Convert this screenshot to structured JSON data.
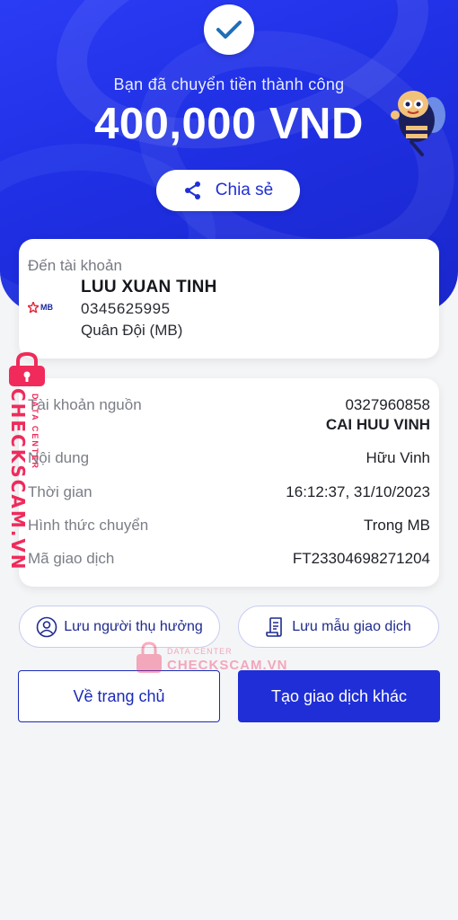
{
  "header": {
    "success_message": "Bạn đã chuyển tiền thành công",
    "amount": "400,000 VND",
    "share_label": "Chia sẻ"
  },
  "recipient": {
    "title": "Đến tài khoản",
    "bank_logo_text": "MB",
    "name": "LUU XUAN TINH",
    "account_number": "0345625995",
    "bank_name": "Quân Đội (MB)"
  },
  "details": {
    "source_label": "Tài khoản nguồn",
    "source_account": "0327960858",
    "source_name": "CAI HUU VINH",
    "content_label": "Nội dung",
    "content_value": "Hữu Vinh",
    "time_label": "Thời gian",
    "time_value": "16:12:37, 31/10/2023",
    "method_label": "Hình thức chuyển",
    "method_value": "Trong MB",
    "tx_id_label": "Mã giao dịch",
    "tx_id_value": "FT23304698271204"
  },
  "actions": {
    "save_beneficiary": "Lưu người thụ hưởng",
    "save_template": "Lưu mẫu giao dịch",
    "home": "Về trang chủ",
    "new_transaction": "Tạo giao dịch khác"
  },
  "watermark": {
    "big_text": "CHECKSCAM.VN",
    "small_text": "DATA CENTER",
    "center_small": "DATA CENTER",
    "center_big": "CHECKSCAM.VN"
  },
  "colors": {
    "brand_blue": "#1f2ed6",
    "watermark_red": "#f02a5a"
  }
}
